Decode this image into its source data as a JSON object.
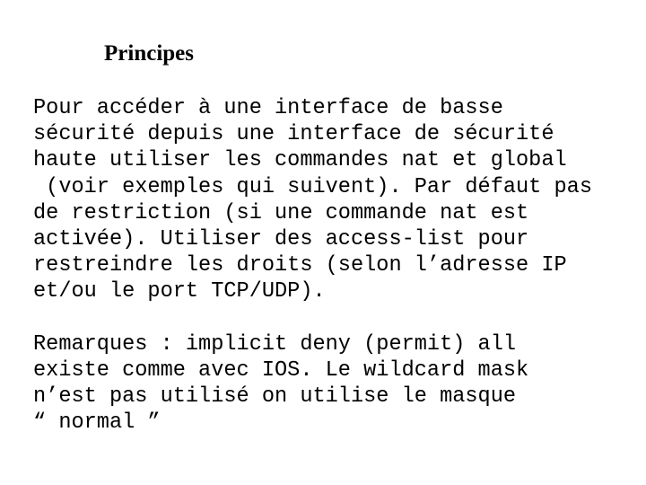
{
  "slide": {
    "title": "Principes",
    "background_color": "#ffffff",
    "text_color": "#000000",
    "paragraphs": [
      {
        "id": "principes-body",
        "lines": [
          "Pour accéder à une interface de basse",
          "sécurité depuis une interface de sécurité",
          "haute utiliser les commandes nat et global",
          " (voir exemples qui suivent). Par défaut pas",
          "de restriction (si une commande nat est",
          "activée). Utiliser des access-list pour",
          "restreindre les droits (selon l’adresse IP",
          "et/ou le port TCP/UDP)."
        ]
      },
      {
        "id": "remarques-body",
        "lines": [
          "Remarques : implicit deny (permit) all",
          "existe comme avec IOS. Le wildcard mask",
          "n’est pas utilisé on utilise le masque",
          "“ normal ”"
        ]
      }
    ]
  }
}
